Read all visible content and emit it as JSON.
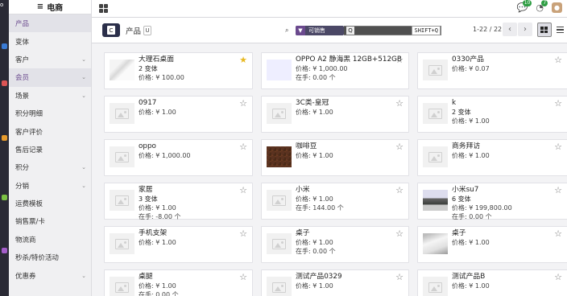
{
  "app": {
    "title": "电商"
  },
  "sidebar": {
    "items": [
      {
        "label": "产品",
        "active": true,
        "chevron": false
      },
      {
        "label": "变体",
        "active": false,
        "chevron": false
      },
      {
        "label": "客户",
        "active": false,
        "chevron": true
      },
      {
        "label": "会员",
        "active": true,
        "chevron": true
      },
      {
        "label": "场景",
        "active": false,
        "chevron": true
      },
      {
        "label": "积分明细",
        "active": false,
        "chevron": false
      },
      {
        "label": "客户评价",
        "active": false,
        "chevron": false
      },
      {
        "label": "售后记录",
        "active": false,
        "chevron": false
      },
      {
        "label": "积分",
        "active": false,
        "chevron": true
      },
      {
        "label": "分销",
        "active": false,
        "chevron": true
      },
      {
        "label": "运费模板",
        "active": false,
        "chevron": false
      },
      {
        "label": "销售票/卡",
        "active": false,
        "chevron": false
      },
      {
        "label": "物流商",
        "active": false,
        "chevron": false
      },
      {
        "label": "秒杀/特价活动",
        "active": false,
        "chevron": false
      },
      {
        "label": "优惠券",
        "active": false,
        "chevron": true
      }
    ]
  },
  "topbar": {
    "notifications": [
      {
        "icon": "chat-icon",
        "count": "10",
        "color": "#2f9e44"
      },
      {
        "icon": "activity-icon",
        "count": "7",
        "color": "#2f9e44"
      }
    ]
  },
  "control": {
    "new_label": "C",
    "breadcrumb": "产品",
    "gear_label": "U",
    "facet_label": "可销售",
    "search_key": "Q",
    "shortcut_hint": "SHIFT+Q",
    "pager": "1-22 / 22"
  },
  "products": [
    {
      "name": "大理石桌面",
      "variants": "2 变体",
      "price": "价格: ¥ 100.00",
      "stock": "",
      "image": "marble",
      "favorite": true
    },
    {
      "name": "OPPO A2 静海黑 12GB+512GB",
      "variants": "",
      "price": "价格: ¥ 1,000.00",
      "stock": "在手:   0.00 个",
      "image": "phone",
      "favorite": false
    },
    {
      "name": "0330产品",
      "variants": "",
      "price": "价格: ¥ 0.07",
      "stock": "",
      "image": "",
      "favorite": false
    },
    {
      "name": "0917",
      "variants": "",
      "price": "价格: ¥ 1.00",
      "stock": "",
      "image": "",
      "favorite": false
    },
    {
      "name": "3C类-皇冠",
      "variants": "",
      "price": "价格: ¥ 1.00",
      "stock": "",
      "image": "",
      "favorite": false
    },
    {
      "name": "k",
      "variants": "2 变体",
      "price": "价格: ¥ 1.00",
      "stock": "",
      "image": "",
      "favorite": false
    },
    {
      "name": "oppo",
      "variants": "",
      "price": "价格: ¥ 1,000.00",
      "stock": "",
      "image": "",
      "favorite": false
    },
    {
      "name": "咖啡豆",
      "variants": "",
      "price": "价格: ¥ 1.00",
      "stock": "",
      "image": "coffee",
      "favorite": false
    },
    {
      "name": "商务拜访",
      "variants": "",
      "price": "价格: ¥ 1.00",
      "stock": "",
      "image": "",
      "favorite": false
    },
    {
      "name": "家居",
      "variants": "3 变体",
      "price": "价格: ¥ 1.00",
      "stock": "在手:  -8.00 个",
      "image": "",
      "favorite": false
    },
    {
      "name": "小米",
      "variants": "",
      "price": "价格: ¥ 1.00",
      "stock": "在手:   144.00 个",
      "image": "",
      "favorite": false
    },
    {
      "name": "小米su7",
      "variants": "6 变体",
      "price": "价格: ¥ 199,800.00",
      "stock": "在手:   0.00 个",
      "image": "car",
      "favorite": false
    },
    {
      "name": "手机支架",
      "variants": "",
      "price": "价格: ¥ 1.00",
      "stock": "",
      "image": "",
      "favorite": false
    },
    {
      "name": "桌子",
      "variants": "",
      "price": "价格: ¥ 1.00",
      "stock": "在手:   0.00 个",
      "image": "",
      "favorite": false
    },
    {
      "name": "桌子",
      "variants": "",
      "price": "价格: ¥ 1.00",
      "stock": "",
      "image": "table",
      "favorite": false
    },
    {
      "name": "桌腿",
      "variants": "",
      "price": "价格: ¥ 1.00",
      "stock": "在手:   0.00 个",
      "image": "",
      "favorite": false
    },
    {
      "name": "测试产品0329",
      "variants": "",
      "price": "价格: ¥ 1.00",
      "stock": "",
      "image": "",
      "favorite": false
    },
    {
      "name": "测试产品B",
      "variants": "",
      "price": "价格: ¥ 1.00",
      "stock": "",
      "image": "",
      "favorite": false
    }
  ]
}
